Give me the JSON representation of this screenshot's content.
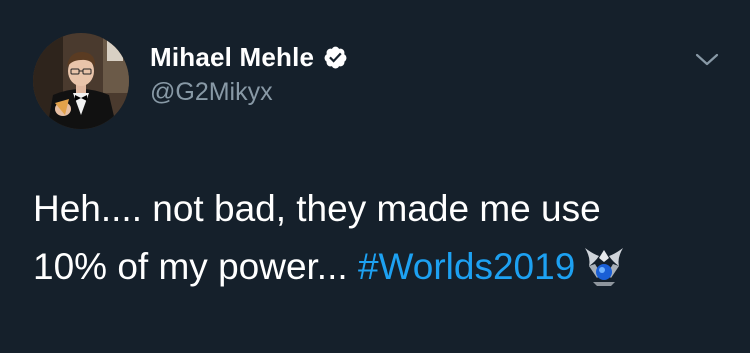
{
  "author": {
    "display_name": "Mihael Mehle",
    "handle": "@G2Mikyx",
    "verified": true
  },
  "tweet": {
    "line1": "Heh.... not bad, they made me use",
    "line2_prefix": "10% of my power... ",
    "hashtag": "#Worlds2019",
    "hashflag_icon": "worlds-trophy-icon"
  },
  "colors": {
    "background": "#15202b",
    "text": "#ffffff",
    "secondary_text": "#8899a6",
    "link": "#1da1f2"
  }
}
